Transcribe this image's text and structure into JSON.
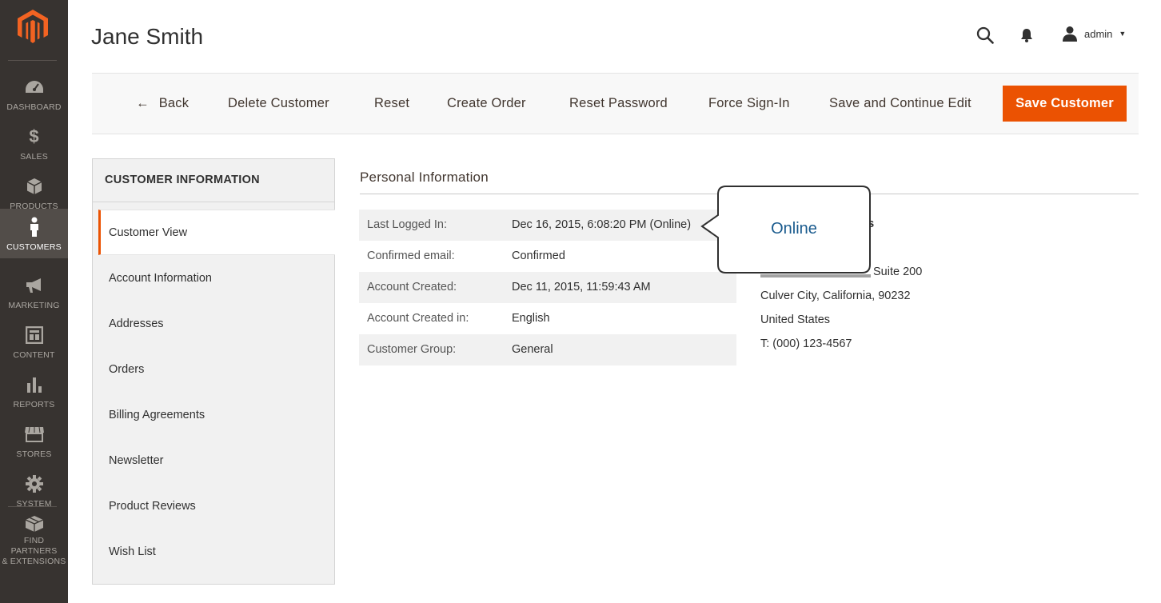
{
  "nav": {
    "items": [
      {
        "label": "DASHBOARD",
        "icon": "dashboard-icon"
      },
      {
        "label": "SALES",
        "icon": "dollar-icon"
      },
      {
        "label": "PRODUCTS",
        "icon": "box-icon"
      },
      {
        "label": "CUSTOMERS",
        "icon": "person-icon",
        "active": true
      },
      {
        "label": "MARKETING",
        "icon": "megaphone-icon"
      },
      {
        "label": "CONTENT",
        "icon": "layout-icon"
      },
      {
        "label": "REPORTS",
        "icon": "bar-chart-icon"
      },
      {
        "label": "STORES",
        "icon": "store-icon"
      },
      {
        "label": "SYSTEM",
        "icon": "gear-icon"
      }
    ],
    "partners": {
      "line1": "FIND PARTNERS",
      "line2": "& EXTENSIONS",
      "icon": "cube-icon"
    }
  },
  "header": {
    "title": "Jane Smith",
    "user": "admin"
  },
  "actions": {
    "back": "Back",
    "delete": "Delete Customer",
    "reset": "Reset",
    "create_order": "Create Order",
    "reset_password": "Reset Password",
    "force_signin": "Force Sign-In",
    "save_continue": "Save and Continue Edit",
    "save": "Save Customer"
  },
  "sidebar": {
    "title": "CUSTOMER INFORMATION",
    "tabs": [
      "Customer View",
      "Account Information",
      "Addresses",
      "Orders",
      "Billing Agreements",
      "Newsletter",
      "Product Reviews",
      "Wish List"
    ]
  },
  "personal": {
    "title": "Personal Information",
    "rows": [
      {
        "key": "Last Logged In:",
        "value": "Dec 16, 2015, 6:08:20 PM (Online)"
      },
      {
        "key": "Confirmed email:",
        "value": "Confirmed"
      },
      {
        "key": "Account Created:",
        "value": "Dec 11, 2015, 11:59:43 AM"
      },
      {
        "key": "Account Created in:",
        "value": "English"
      },
      {
        "key": "Customer Group:",
        "value": "General"
      }
    ]
  },
  "address": {
    "heading_visible": "ess",
    "line_partial": "Suite 200",
    "city": "Culver City, California, 90232",
    "country": "United States",
    "phone": "T: (000) 123-4567"
  },
  "callout": {
    "text": "Online"
  },
  "colors": {
    "nav_bg": "#373330",
    "nav_active": "#524d49",
    "accent": "#eb5202",
    "callout_text": "#1a5b8e"
  }
}
